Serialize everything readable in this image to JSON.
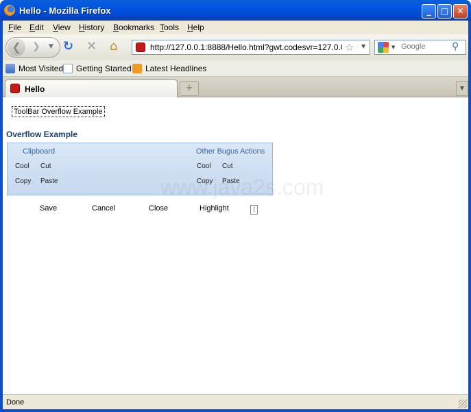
{
  "window": {
    "title": "Hello - Mozilla Firefox"
  },
  "menu": [
    "File",
    "Edit",
    "View",
    "History",
    "Bookmarks",
    "Tools",
    "Help"
  ],
  "nav": {
    "url": "http://127.0.0.1:8888/Hello.html?gwt.codesvr=127.0.0.",
    "search_placeholder": "Google"
  },
  "bookmarks": [
    "Most Visited",
    "Getting Started",
    "Latest Headlines"
  ],
  "tab": {
    "title": "Hello",
    "new_tab": "+"
  },
  "content": {
    "demo_link": "ToolBar Overflow Example",
    "heading": "Overflow Example",
    "clipboard_group": {
      "title": "Clipboard",
      "buttons": [
        "Cool",
        "Cut",
        "Copy",
        "Paste"
      ]
    },
    "other_group": {
      "title": "Other Bugus Actions",
      "buttons": [
        "Cool",
        "Cut",
        "Copy",
        "Paste"
      ]
    },
    "actions": [
      "Save",
      "Cancel",
      "Close",
      "Highlight"
    ],
    "overflow_symbol": "[",
    "watermark": "www.java2s.com"
  },
  "status": {
    "text": "Done"
  },
  "colors": {
    "titlebar": "#0054e3",
    "panel": "#c6d8ef",
    "heading": "#1b3d6f",
    "group_title": "#3664a8"
  }
}
